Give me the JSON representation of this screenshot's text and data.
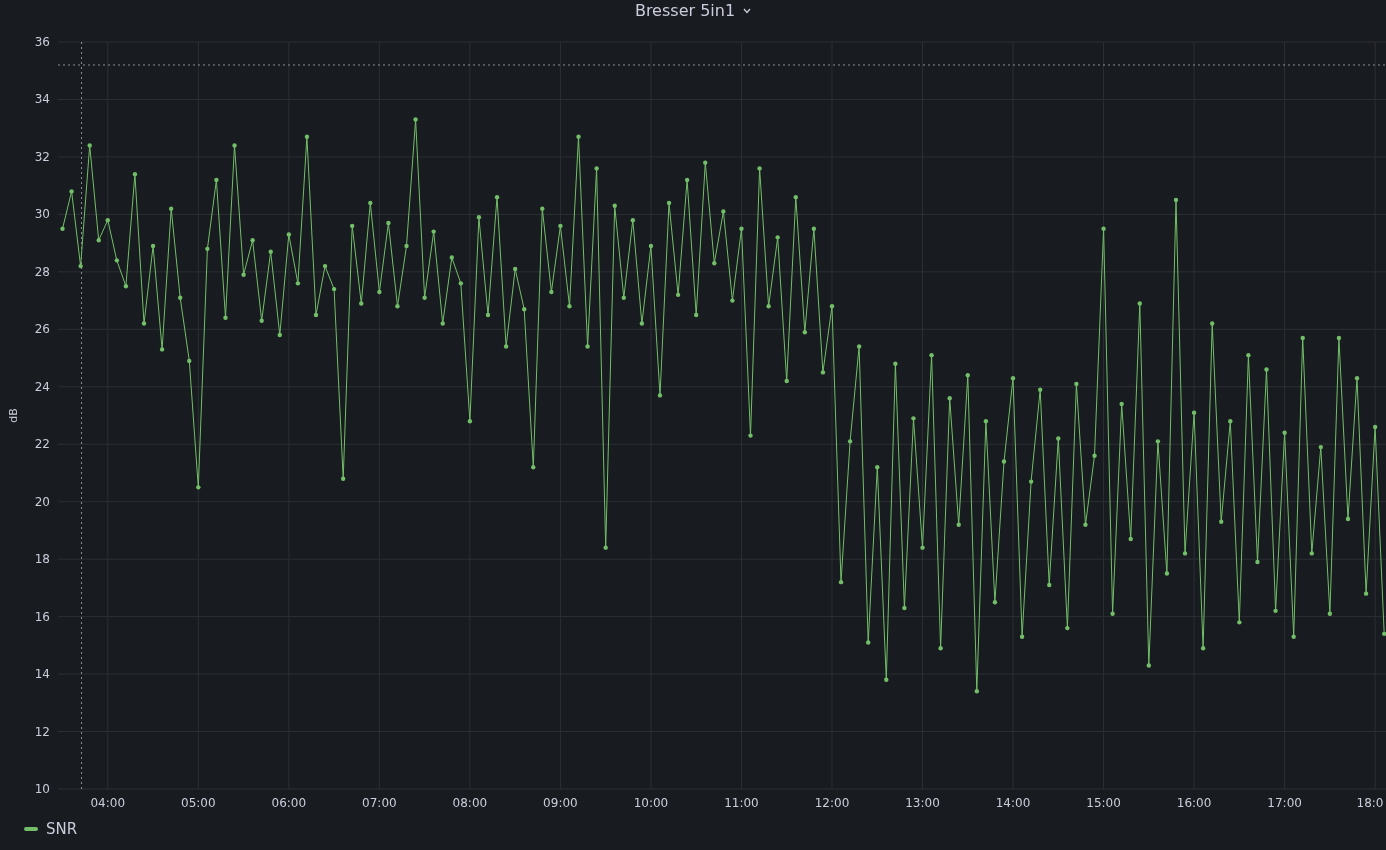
{
  "panel": {
    "title": "Bresser 5in1"
  },
  "chart_data": {
    "type": "line",
    "ylabel": "dB",
    "xlim": [
      3.45,
      18.12
    ],
    "ylim": [
      10,
      36
    ],
    "yticks": [
      10,
      12,
      14,
      16,
      18,
      20,
      22,
      24,
      26,
      28,
      30,
      32,
      34,
      36
    ],
    "xticks": [
      {
        "value": 4,
        "label": "04:00"
      },
      {
        "value": 5,
        "label": "05:00"
      },
      {
        "value": 6,
        "label": "06:00"
      },
      {
        "value": 7,
        "label": "07:00"
      },
      {
        "value": 8,
        "label": "08:00"
      },
      {
        "value": 9,
        "label": "09:00"
      },
      {
        "value": 10,
        "label": "10:00"
      },
      {
        "value": 11,
        "label": "11:00"
      },
      {
        "value": 12,
        "label": "12:00"
      },
      {
        "value": 13,
        "label": "13:00"
      },
      {
        "value": 14,
        "label": "14:00"
      },
      {
        "value": 15,
        "label": "15:00"
      },
      {
        "value": 16,
        "label": "16:00"
      },
      {
        "value": 17,
        "label": "17:00"
      },
      {
        "value": 18,
        "label": "18:0"
      }
    ],
    "grid": true,
    "x": [
      3.5,
      3.6,
      3.7,
      3.8,
      3.9,
      4.0,
      4.1,
      4.2,
      4.3,
      4.4,
      4.5,
      4.6,
      4.7,
      4.8,
      4.9,
      5.0,
      5.1,
      5.2,
      5.3,
      5.4,
      5.5,
      5.6,
      5.7,
      5.8,
      5.9,
      6.0,
      6.1,
      6.2,
      6.3,
      6.4,
      6.5,
      6.6,
      6.7,
      6.8,
      6.9,
      7.0,
      7.1,
      7.2,
      7.3,
      7.4,
      7.5,
      7.6,
      7.7,
      7.8,
      7.9,
      8.0,
      8.1,
      8.2,
      8.3,
      8.4,
      8.5,
      8.6,
      8.7,
      8.8,
      8.9,
      9.0,
      9.1,
      9.2,
      9.3,
      9.4,
      9.5,
      9.6,
      9.7,
      9.8,
      9.9,
      10.0,
      10.1,
      10.2,
      10.3,
      10.4,
      10.5,
      10.6,
      10.7,
      10.8,
      10.9,
      11.0,
      11.1,
      11.2,
      11.3,
      11.4,
      11.5,
      11.6,
      11.7,
      11.8,
      11.9,
      12.0,
      12.1,
      12.2,
      12.3,
      12.4,
      12.5,
      12.6,
      12.7,
      12.8,
      12.9,
      13.0,
      13.1,
      13.2,
      13.3,
      13.4,
      13.5,
      13.6,
      13.7,
      13.8,
      13.9,
      14.0,
      14.1,
      14.2,
      14.3,
      14.4,
      14.5,
      14.6,
      14.7,
      14.8,
      14.9,
      15.0,
      15.1,
      15.2,
      15.3,
      15.4,
      15.5,
      15.6,
      15.7,
      15.8,
      15.9,
      16.0,
      16.1,
      16.2,
      16.3,
      16.4,
      16.5,
      16.6,
      16.7,
      16.8,
      16.9,
      17.0,
      17.1,
      17.2,
      17.3,
      17.4,
      17.5,
      17.6,
      17.7,
      17.8,
      17.9,
      18.0,
      18.1
    ],
    "series": [
      {
        "name": "SNR",
        "color": "#73bf69",
        "values": [
          29.5,
          30.8,
          28.2,
          32.4,
          29.1,
          29.8,
          28.4,
          27.5,
          31.4,
          26.2,
          28.9,
          25.3,
          30.2,
          27.1,
          24.9,
          20.5,
          28.8,
          31.2,
          26.4,
          32.4,
          27.9,
          29.1,
          26.3,
          28.7,
          25.8,
          29.3,
          27.6,
          32.7,
          26.5,
          28.2,
          27.4,
          20.8,
          29.6,
          26.9,
          30.4,
          27.3,
          29.7,
          26.8,
          28.9,
          33.3,
          27.1,
          29.4,
          26.2,
          28.5,
          27.6,
          22.8,
          29.9,
          26.5,
          30.6,
          25.4,
          28.1,
          26.7,
          21.2,
          30.2,
          27.3,
          29.6,
          26.8,
          32.7,
          25.4,
          31.6,
          18.4,
          30.3,
          27.1,
          29.8,
          26.2,
          28.9,
          23.7,
          30.4,
          27.2,
          31.2,
          26.5,
          31.8,
          28.3,
          30.1,
          27.0,
          29.5,
          22.3,
          31.6,
          26.8,
          29.2,
          24.2,
          30.6,
          25.9,
          29.5,
          24.5,
          26.8,
          17.2,
          22.1,
          25.4,
          15.1,
          21.2,
          13.8,
          24.8,
          16.3,
          22.9,
          18.4,
          25.1,
          14.9,
          23.6,
          19.2,
          24.4,
          13.4,
          22.8,
          16.5,
          21.4,
          24.3,
          15.3,
          20.7,
          23.9,
          17.1,
          22.2,
          15.6,
          24.1,
          19.2,
          21.6,
          29.5,
          16.1,
          23.4,
          18.7,
          26.9,
          14.3,
          22.1,
          17.5,
          30.5,
          18.2,
          23.1,
          14.9,
          26.2,
          19.3,
          22.8,
          15.8,
          25.1,
          17.9,
          24.6,
          16.2,
          22.4,
          15.3,
          25.7,
          18.2,
          21.9,
          16.1,
          25.7,
          19.4,
          24.3,
          16.8,
          22.6,
          15.4
        ]
      }
    ],
    "ref_lines": [
      {
        "axis": "y",
        "value": 35.2
      },
      {
        "axis": "x",
        "value": 3.71
      }
    ]
  }
}
